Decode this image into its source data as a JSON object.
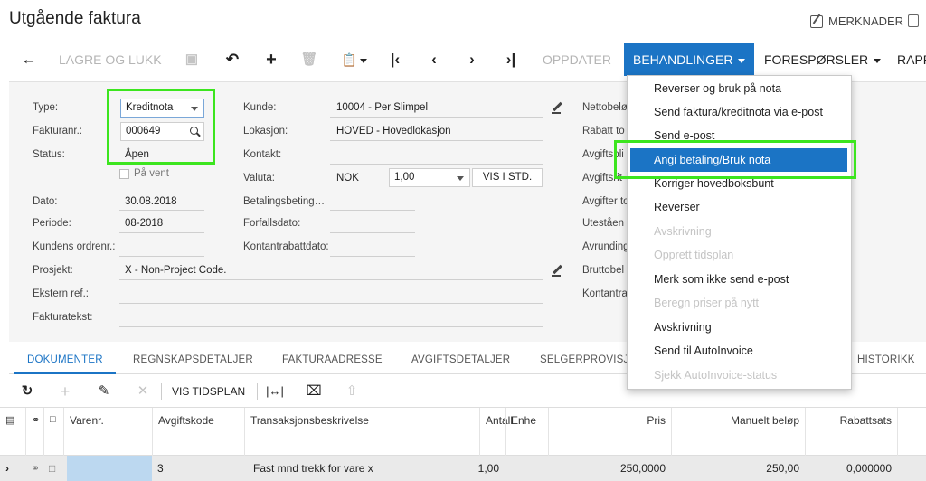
{
  "header": {
    "title": "Utgående faktura",
    "notes_label": "MERKNADER"
  },
  "toolbar": {
    "save_close": "LAGRE OG LUKK",
    "refresh": "OPPDATER",
    "actions": "BEHANDLINGER",
    "inquiries": "FORESPØRSLER",
    "reports": "RAPP"
  },
  "form": {
    "type_label": "Type:",
    "type_value": "Kreditnota",
    "refnbr_label": "Fakturanr.:",
    "refnbr_value": "000649",
    "status_label": "Status:",
    "status_value": "Åpen",
    "hold_label": "På vent",
    "date_label": "Dato:",
    "date_value": "30.08.2018",
    "period_label": "Periode:",
    "period_value": "08-2018",
    "customer_order_label": "Kundens ordrenr.:",
    "customer_order_value": "",
    "project_label": "Prosjekt:",
    "project_value": "X - Non-Project Code.",
    "external_ref_label": "Ekstern ref.:",
    "external_ref_value": "",
    "invoice_text_label": "Fakturatekst:",
    "invoice_text_value": "",
    "customer_label": "Kunde:",
    "customer_value": "10004 - Per Slimpel",
    "location_label": "Lokasjon:",
    "location_value": "HOVED - Hovedlokasjon",
    "contact_label": "Kontakt:",
    "contact_value": "",
    "currency_label": "Valuta:",
    "currency_value": "NOK",
    "rate_value": "1,00",
    "view_base_label": "VIS I STD.",
    "terms_label": "Betalingsbeting…",
    "due_date_label": "Forfallsdato:",
    "cash_discount_label": "Kontantrabattdato:",
    "right_labels": [
      "Nettobelø",
      "Rabatt to",
      "Avgiftspli",
      "Avgiftsrit",
      "Avgifter to",
      "Uteståen",
      "Avrunding",
      "Bruttobel",
      "Kontantra"
    ]
  },
  "tabs": [
    "DOKUMENTER",
    "REGNSKAPSDETALJER",
    "FAKTURAADRESSE",
    "AVGIFTSDETALJER",
    "SELGERPROVISJ",
    "HISTORIKK"
  ],
  "gridbar": {
    "view_schedule": "VIS TIDSPLAN"
  },
  "grid": {
    "headers": {
      "item": "Varenr.",
      "tax": "Avgiftskode",
      "description": "Transaksjonsbeskrivelse",
      "qty": "Antall",
      "uom": "Enhe",
      "price": "Pris",
      "manual": "Manuelt beløp",
      "discount": "Rabattsats"
    },
    "row": {
      "item": "",
      "tax": "3",
      "description": "Fast mnd trekk for vare x",
      "qty": "1,00",
      "uom": "",
      "price": "250,0000",
      "manual": "250,00",
      "discount": "0,000000"
    }
  },
  "dropdown": {
    "items": [
      {
        "label": "Reverser og bruk på nota",
        "state": "normal"
      },
      {
        "label": "Send faktura/kreditnota via e-post",
        "state": "normal"
      },
      {
        "label": "Send e-post",
        "state": "normal"
      },
      {
        "label": "Angi betaling/Bruk nota",
        "state": "active"
      },
      {
        "label": "Korriger hovedboksbunt",
        "state": "normal"
      },
      {
        "label": "Reverser",
        "state": "normal"
      },
      {
        "label": "Avskrivning",
        "state": "disabled"
      },
      {
        "label": "Opprett tidsplan",
        "state": "disabled"
      },
      {
        "label": "Merk som ikke send e-post",
        "state": "normal"
      },
      {
        "label": "Beregn priser på nytt",
        "state": "disabled"
      },
      {
        "label": "Avskrivning",
        "state": "normal"
      },
      {
        "label": "Send til AutoInvoice",
        "state": "normal"
      },
      {
        "label": "Sjekk AutoInvoice-status",
        "state": "disabled"
      }
    ]
  },
  "colors": {
    "accent": "#1b74c5",
    "highlight": "#3ce51e",
    "disabled": "#c4c4c4"
  }
}
